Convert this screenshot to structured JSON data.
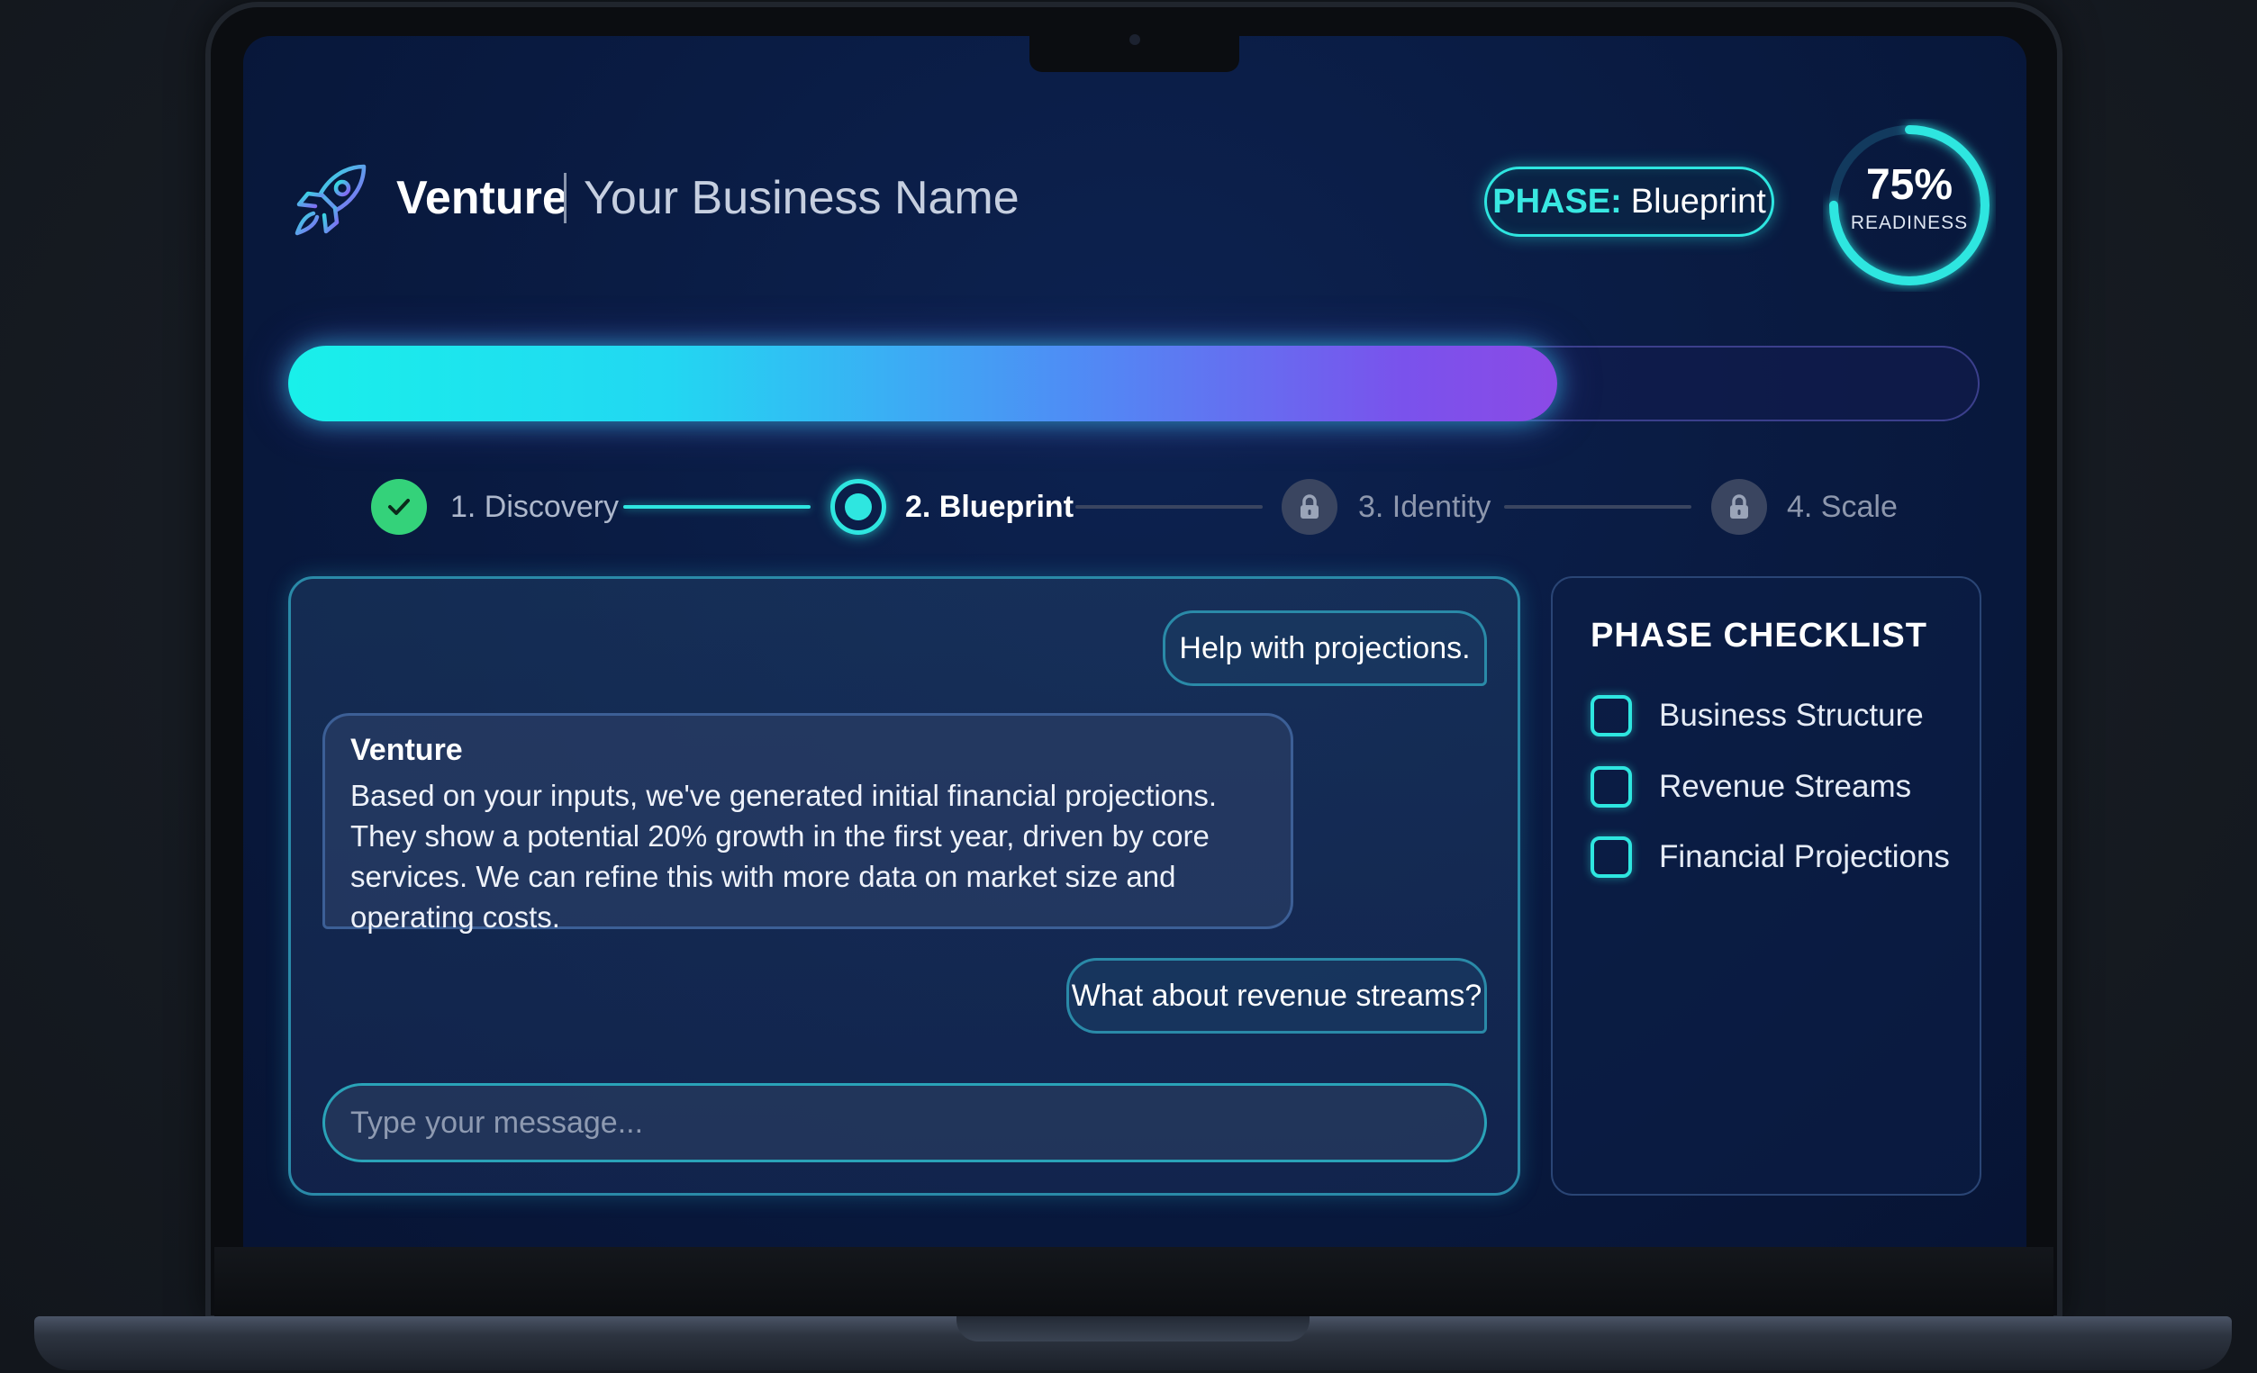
{
  "header": {
    "app_name": "Venture",
    "business_name": "Your Business Name",
    "phase_label": "PHASE:",
    "phase_value": "Blueprint",
    "readiness_value": "75%",
    "readiness_label": "READINESS",
    "readiness_fraction": 0.75
  },
  "progress": {
    "fraction": 0.75
  },
  "stepper": {
    "steps": [
      {
        "label": "1. Discovery",
        "state": "done",
        "icon": "check-icon"
      },
      {
        "label": "2. Blueprint",
        "state": "active",
        "icon": "active-dot-icon"
      },
      {
        "label": "3. Identity",
        "state": "locked",
        "icon": "lock-icon"
      },
      {
        "label": "4. Scale",
        "state": "locked",
        "icon": "lock-icon"
      }
    ]
  },
  "chat": {
    "messages": [
      {
        "role": "user",
        "text": "Help with projections."
      },
      {
        "role": "assistant",
        "sender": "Venture",
        "text": "Based on your inputs, we've generated initial financial projections. They show a potential 20% growth in the first year, driven by core services. We can refine this with more data on market size and operating costs."
      },
      {
        "role": "user",
        "text": "What about revenue streams?"
      }
    ],
    "input_placeholder": "Type your message..."
  },
  "checklist": {
    "title": "PHASE CHECKLIST",
    "items": [
      {
        "label": "Business Structure",
        "checked": false
      },
      {
        "label": "Revenue Streams",
        "checked": false
      },
      {
        "label": "Financial Projections",
        "checked": false
      }
    ]
  },
  "colors": {
    "accent_cyan": "#2ee6e0",
    "accent_purple": "#8b4ae6",
    "done_green": "#34d27a",
    "background_navy": "#091a40"
  }
}
